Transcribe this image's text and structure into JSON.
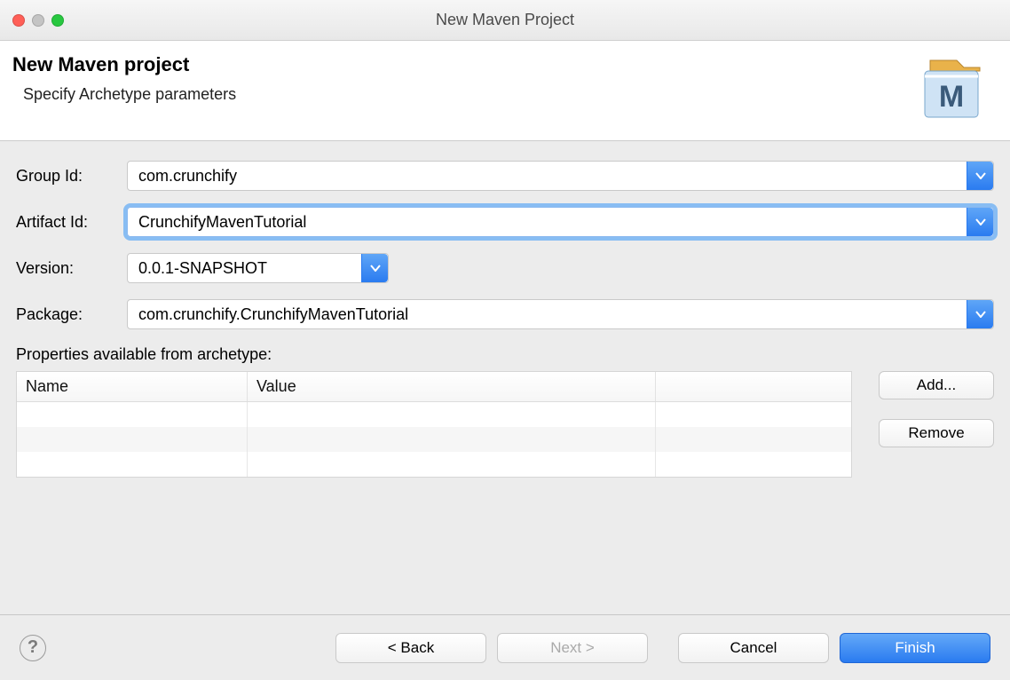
{
  "window": {
    "title": "New Maven Project"
  },
  "banner": {
    "heading": "New Maven project",
    "subheading": "Specify Archetype parameters"
  },
  "form": {
    "groupId": {
      "label": "Group Id:",
      "value": "com.crunchify"
    },
    "artifactId": {
      "label": "Artifact Id:",
      "value": "CrunchifyMavenTutorial"
    },
    "version": {
      "label": "Version:",
      "value": "0.0.1-SNAPSHOT"
    },
    "package": {
      "label": "Package:",
      "value": "com.crunchify.CrunchifyMavenTutorial"
    }
  },
  "properties": {
    "section_label": "Properties available from archetype:",
    "columns": {
      "name": "Name",
      "value": "Value"
    },
    "add_label": "Add...",
    "remove_label": "Remove"
  },
  "footer": {
    "back": "< Back",
    "next": "Next >",
    "cancel": "Cancel",
    "finish": "Finish"
  }
}
